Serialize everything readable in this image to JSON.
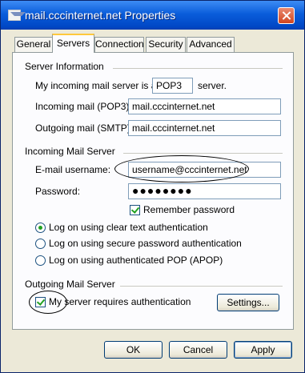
{
  "window": {
    "title": "mail.cccinternet.net  Properties"
  },
  "tabs": [
    {
      "label": "General"
    },
    {
      "label": "Servers"
    },
    {
      "label": "Connection"
    },
    {
      "label": "Security"
    },
    {
      "label": "Advanced"
    }
  ],
  "server_info": {
    "heading": "Server Information",
    "incoming_type_prefix": "My incoming mail server is a",
    "incoming_type_value": "POP3",
    "incoming_type_suffix": "server.",
    "incoming_label": "Incoming mail (POP3):",
    "incoming_value": "mail.cccinternet.net",
    "outgoing_label": "Outgoing mail (SMTP):",
    "outgoing_value": "mail.cccinternet.net"
  },
  "incoming_server": {
    "heading": "Incoming Mail Server",
    "username_label": "E-mail username:",
    "username_value": "username@cccinternet.net",
    "password_label": "Password:",
    "password_value": "●●●●●●●●",
    "remember_password_label": "Remember password",
    "remember_password_checked": true,
    "auth_options": [
      {
        "label": "Log on using clear text authentication",
        "selected": true
      },
      {
        "label": "Log on using secure password authentication",
        "selected": false
      },
      {
        "label": "Log on using authenticated POP (APOP)",
        "selected": false
      }
    ]
  },
  "outgoing_server": {
    "heading": "Outgoing Mail Server",
    "requires_auth_label": "My server requires authentication",
    "requires_auth_checked": true,
    "settings_button": "Settings..."
  },
  "footer": {
    "ok": "OK",
    "cancel": "Cancel",
    "apply": "Apply"
  }
}
